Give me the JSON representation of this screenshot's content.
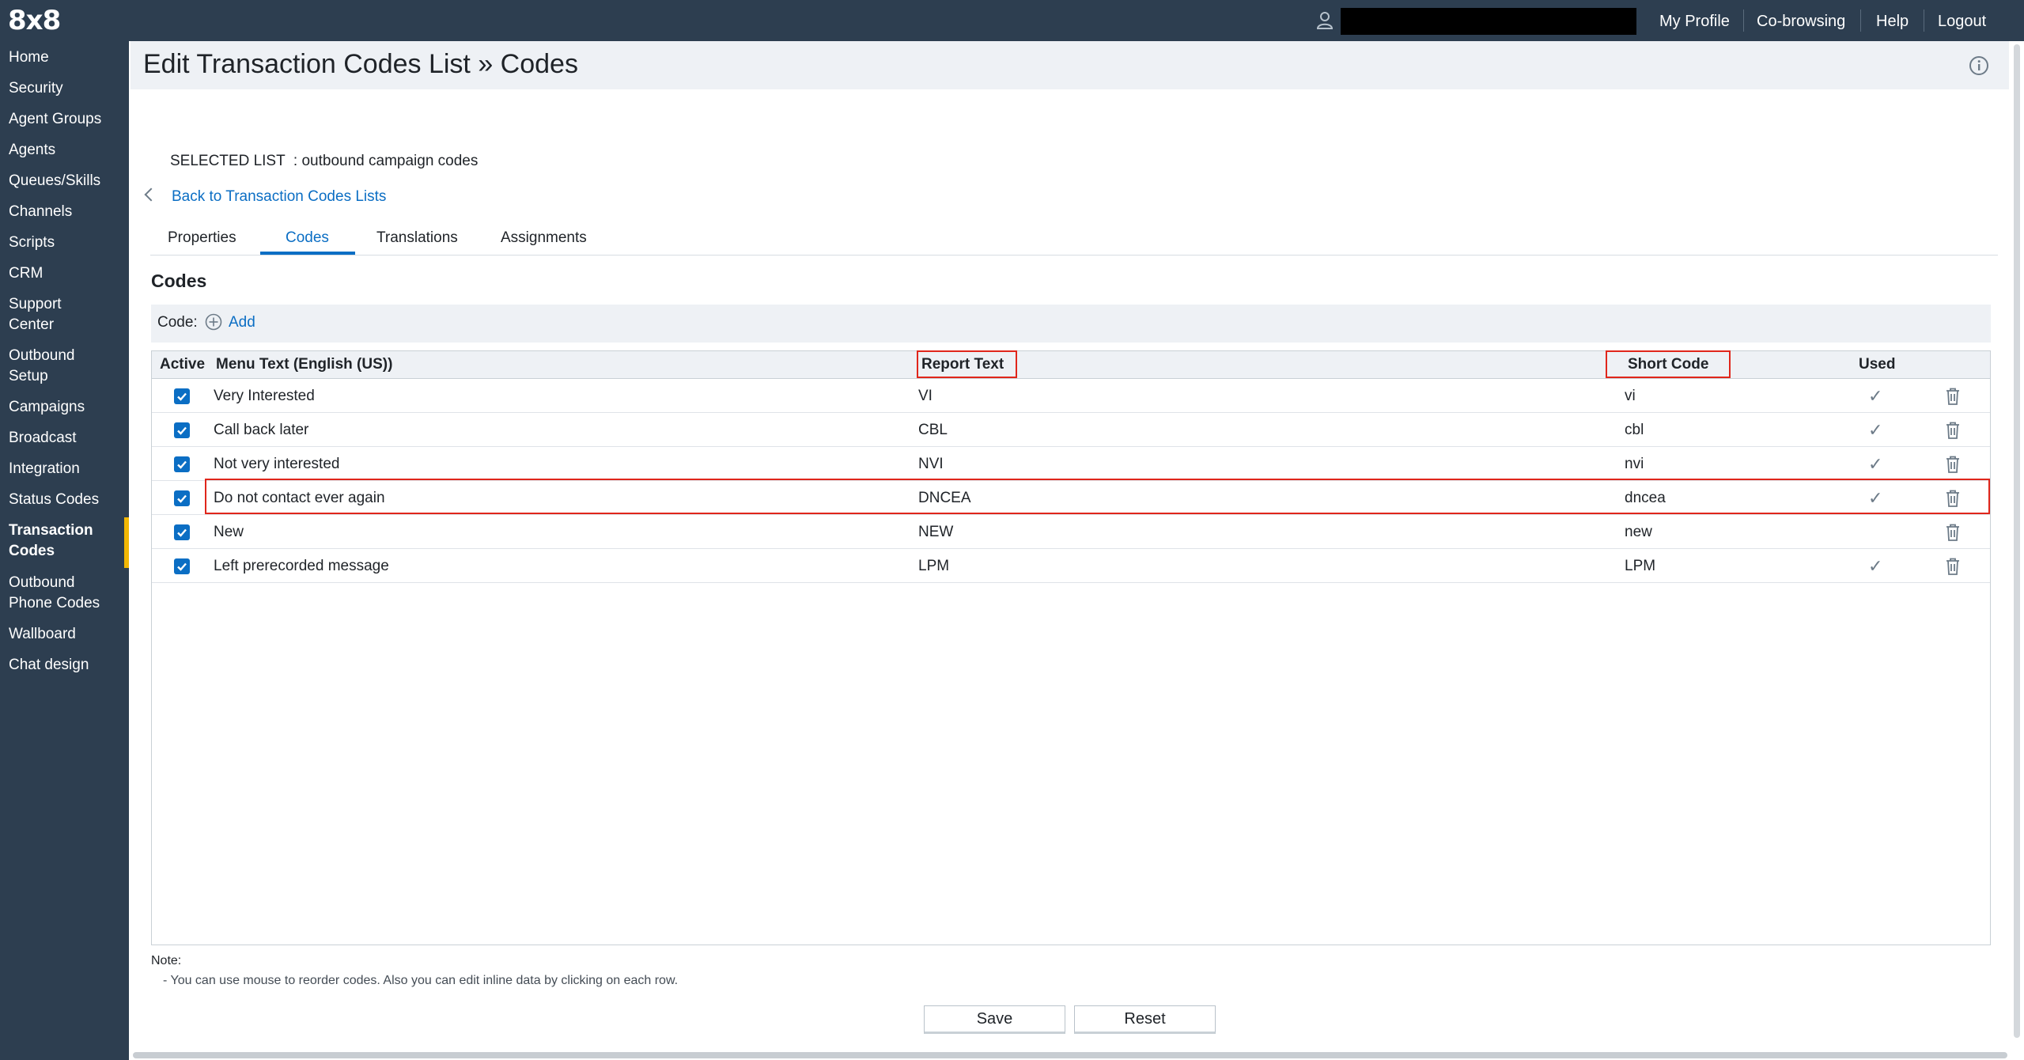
{
  "app": {
    "logo": "8x8"
  },
  "topbar": {
    "user_name": "",
    "links": [
      "My Profile",
      "Co-browsing",
      "Help",
      "Logout"
    ]
  },
  "sidebar": {
    "items": [
      {
        "label": "Home"
      },
      {
        "label": "Security"
      },
      {
        "label": "Agent Groups"
      },
      {
        "label": "Agents"
      },
      {
        "label": "Queues/Skills"
      },
      {
        "label": "Channels"
      },
      {
        "label": "Scripts"
      },
      {
        "label": "CRM"
      },
      {
        "label": "Support Center"
      },
      {
        "label": "Outbound Setup"
      },
      {
        "label": "Campaigns"
      },
      {
        "label": "Broadcast"
      },
      {
        "label": "Integration"
      },
      {
        "label": "Status Codes"
      },
      {
        "label": "Transaction Codes"
      },
      {
        "label": "Outbound Phone Codes"
      },
      {
        "label": "Wallboard"
      },
      {
        "label": "Chat design"
      }
    ],
    "active": "Transaction Codes"
  },
  "page": {
    "title": "Edit Transaction Codes List » Codes",
    "selected_list": "SELECTED LIST  : outbound campaign codes",
    "back_link": "Back to Transaction Codes Lists"
  },
  "tabs": [
    {
      "label": "Properties"
    },
    {
      "label": "Codes"
    },
    {
      "label": "Translations"
    },
    {
      "label": "Assignments"
    }
  ],
  "active_tab": "Codes",
  "section": {
    "title": "Codes",
    "code_label": "Code:",
    "add_label": "Add"
  },
  "table": {
    "headers": {
      "active": "Active",
      "menu_text": "Menu Text (English (US))",
      "report_text": "Report Text",
      "short_code": "Short Code",
      "used": "Used"
    },
    "rows": [
      {
        "active": true,
        "menu_text": "Very Interested",
        "report_text": "VI",
        "short_code": "vi",
        "used": true
      },
      {
        "active": true,
        "menu_text": "Call back later",
        "report_text": "CBL",
        "short_code": "cbl",
        "used": true
      },
      {
        "active": true,
        "menu_text": "Not very interested",
        "report_text": "NVI",
        "short_code": "nvi",
        "used": true
      },
      {
        "active": true,
        "menu_text": "Do not contact ever again",
        "report_text": "DNCEA",
        "short_code": "dncea",
        "used": true
      },
      {
        "active": true,
        "menu_text": "New",
        "report_text": "NEW",
        "short_code": "new",
        "used": false
      },
      {
        "active": true,
        "menu_text": "Left prerecorded message",
        "report_text": "LPM",
        "short_code": "LPM",
        "used": true
      }
    ]
  },
  "note": {
    "label": "Note:",
    "text": "- You can use mouse to reorder codes. Also you can edit inline data by clicking on each row."
  },
  "buttons": {
    "save": "Save",
    "reset": "Reset"
  },
  "colors": {
    "sidebar_bg": "#2d3e50",
    "accent_blue": "#0b6ec4",
    "active_marker": "#f2b705",
    "highlight_red": "#e0261b",
    "band_bg": "#eef1f5"
  },
  "icons": {
    "user": "user-icon",
    "info": "info-icon",
    "back": "chevron-left-icon",
    "add": "plus-circle-icon",
    "checkbox": "checkbox-checked-icon",
    "used": "checkmark-icon",
    "delete": "trash-icon"
  }
}
